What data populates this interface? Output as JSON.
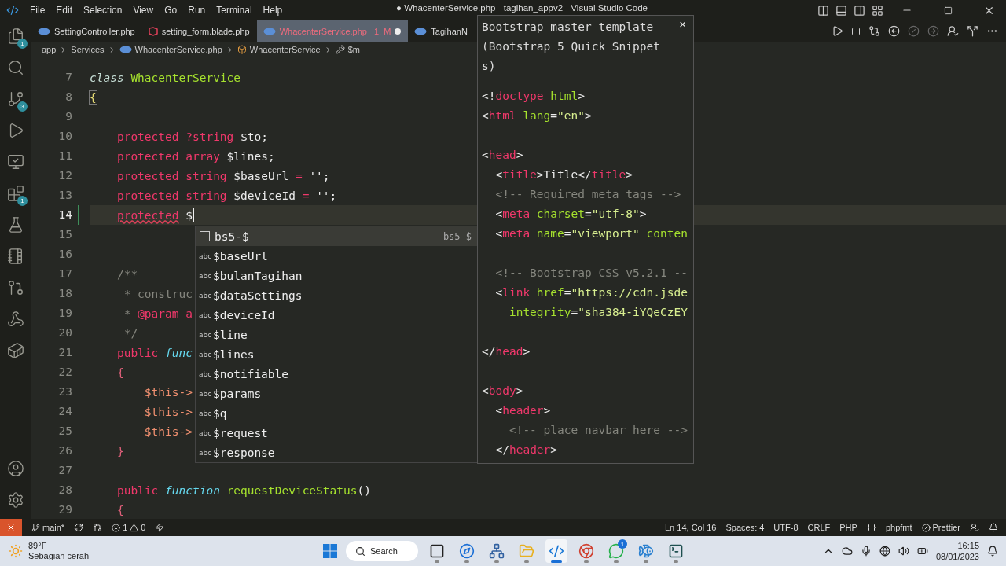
{
  "window": {
    "title": "● WhacenterService.php - tagihan_appv2 - Visual Studio Code"
  },
  "menu": [
    "File",
    "Edit",
    "Selection",
    "View",
    "Go",
    "Run",
    "Terminal",
    "Help"
  ],
  "activity_bar": [
    {
      "kind": "explorer",
      "badge": "1"
    },
    {
      "kind": "search"
    },
    {
      "kind": "source-control",
      "badge": "3"
    },
    {
      "kind": "run"
    },
    {
      "kind": "remote"
    },
    {
      "kind": "extensions",
      "badge": "1"
    },
    {
      "kind": "testing"
    },
    {
      "kind": "notebook"
    },
    {
      "kind": "git-graph"
    },
    {
      "kind": "api"
    },
    {
      "kind": "docker"
    }
  ],
  "activity_bottom": [
    {
      "kind": "account"
    },
    {
      "kind": "settings"
    }
  ],
  "tabs": [
    {
      "kind": "php",
      "label": "SettingController.php",
      "modified": false,
      "selected": false
    },
    {
      "kind": "blade",
      "label": "setting_form.blade.php",
      "modified": false,
      "selected": false
    },
    {
      "kind": "php",
      "label": "WhacenterService.php",
      "status": "1, M",
      "modified": true,
      "selected": true
    },
    {
      "kind": "php",
      "label": "TagihanN",
      "modified": false,
      "selected": false
    }
  ],
  "breadcrumb": [
    {
      "kind": "folder",
      "label": "app"
    },
    {
      "kind": "folder",
      "label": "Services"
    },
    {
      "kind": "php",
      "label": "WhacenterService.php"
    },
    {
      "kind": "class",
      "label": "WhacenterService"
    },
    {
      "kind": "property",
      "label": "$m"
    }
  ],
  "editor": {
    "lines": [
      {
        "number": "7",
        "current": false,
        "changed": false,
        "tokens": [
          {
            "kind": "italic",
            "text": "class "
          },
          {
            "kind": "classname",
            "text": "WhacenterService"
          }
        ]
      },
      {
        "number": "8",
        "current": false,
        "changed": false,
        "tokens": [
          {
            "kind": "bracket",
            "text": "{"
          }
        ]
      },
      {
        "number": "9",
        "current": false,
        "changed": false
      },
      {
        "number": "10",
        "current": false,
        "changed": false,
        "tokens": [
          {
            "kind": "keyword",
            "text": "    protected ?string"
          },
          {
            "kind": "plain",
            "text": " $to;"
          }
        ]
      },
      {
        "number": "11",
        "current": false,
        "changed": false,
        "tokens": [
          {
            "kind": "keyword",
            "text": "    protected array"
          },
          {
            "kind": "plain",
            "text": " $lines;"
          }
        ]
      },
      {
        "number": "12",
        "current": false,
        "changed": false,
        "tokens": [
          {
            "kind": "keyword",
            "text": "    protected string"
          },
          {
            "kind": "plain",
            "text": " $baseUrl "
          },
          {
            "kind": "keyword",
            "text": "="
          },
          {
            "kind": "plain",
            "text": " '';"
          }
        ]
      },
      {
        "number": "13",
        "current": false,
        "changed": false,
        "tokens": [
          {
            "kind": "keyword",
            "text": "    protected string"
          },
          {
            "kind": "plain",
            "text": " $deviceId "
          },
          {
            "kind": "keyword",
            "text": "="
          },
          {
            "kind": "plain",
            "text": " '';"
          }
        ]
      },
      {
        "number": "14",
        "current": true,
        "changed": true,
        "tokens": [
          {
            "kind": "error",
            "text": "    protected"
          },
          {
            "kind": "plain",
            "text": " $"
          }
        ]
      },
      {
        "number": "15",
        "current": false,
        "changed": false
      },
      {
        "number": "16",
        "current": false,
        "changed": false
      },
      {
        "number": "17",
        "current": false,
        "changed": false,
        "tokens": [
          {
            "kind": "comment",
            "text": "    /**"
          }
        ]
      },
      {
        "number": "18",
        "current": false,
        "changed": false,
        "tokens": [
          {
            "kind": "comment",
            "text": "     * construc"
          }
        ]
      },
      {
        "number": "19",
        "current": false,
        "changed": false,
        "tokens": [
          {
            "kind": "comment",
            "text": "     * "
          },
          {
            "kind": "keyword",
            "text": "@param a"
          }
        ]
      },
      {
        "number": "20",
        "current": false,
        "changed": false,
        "tokens": [
          {
            "kind": "comment",
            "text": "     */"
          }
        ]
      },
      {
        "number": "21",
        "current": false,
        "changed": false,
        "tokens": [
          {
            "kind": "keyword",
            "text": "    public "
          },
          {
            "kind": "storage",
            "text": "func"
          }
        ]
      },
      {
        "number": "22",
        "current": false,
        "changed": false,
        "tokens": [
          {
            "kind": "brace",
            "text": "    {"
          }
        ]
      },
      {
        "number": "23",
        "current": false,
        "changed": false,
        "tokens": [
          {
            "kind": "this",
            "text": "        $this->"
          }
        ]
      },
      {
        "number": "24",
        "current": false,
        "changed": false,
        "tokens": [
          {
            "kind": "this",
            "text": "        $this->"
          }
        ]
      },
      {
        "number": "25",
        "current": false,
        "changed": false,
        "tokens": [
          {
            "kind": "this",
            "text": "        $this->"
          }
        ]
      },
      {
        "number": "26",
        "current": false,
        "changed": false,
        "tokens": [
          {
            "kind": "brace",
            "text": "    }"
          }
        ]
      },
      {
        "number": "27",
        "current": false,
        "changed": false
      },
      {
        "number": "28",
        "current": false,
        "changed": false,
        "tokens": [
          {
            "kind": "keyword",
            "text": "    public "
          },
          {
            "kind": "storage",
            "text": "function "
          },
          {
            "kind": "function",
            "text": "requestDeviceStatus"
          },
          {
            "kind": "plain",
            "text": "()"
          }
        ]
      },
      {
        "number": "29",
        "current": false,
        "changed": false,
        "tokens": [
          {
            "kind": "brace",
            "text": "    {"
          }
        ]
      }
    ]
  },
  "suggestions": [
    {
      "kind": "snippet",
      "label": "bs5-$",
      "detail": "bs5-$",
      "selected": true
    },
    {
      "kind": "word",
      "icon_label": "abc",
      "label": "$baseUrl",
      "selected": false
    },
    {
      "kind": "word",
      "icon_label": "abc",
      "label": "$bulanTagihan",
      "selected": false
    },
    {
      "kind": "word",
      "icon_label": "abc",
      "label": "$dataSettings",
      "selected": false
    },
    {
      "kind": "word",
      "icon_label": "abc",
      "label": "$deviceId",
      "selected": false
    },
    {
      "kind": "word",
      "icon_label": "abc",
      "label": "$line",
      "selected": false
    },
    {
      "kind": "word",
      "icon_label": "abc",
      "label": "$lines",
      "selected": false
    },
    {
      "kind": "word",
      "icon_label": "abc",
      "label": "$notifiable",
      "selected": false
    },
    {
      "kind": "word",
      "icon_label": "abc",
      "label": "$params",
      "selected": false
    },
    {
      "kind": "word",
      "icon_label": "abc",
      "label": "$q",
      "selected": false
    },
    {
      "kind": "word",
      "icon_label": "abc",
      "label": "$request",
      "selected": false
    },
    {
      "kind": "word",
      "icon_label": "abc",
      "label": "$response",
      "selected": false
    }
  ],
  "snippet_detail": {
    "title": "Bootstrap master template (Bootstrap 5 Quick Snippets)",
    "close": "×",
    "blocks": [
      [
        {
          "tokens": [
            {
              "kind": "punct",
              "text": "<!"
            },
            {
              "kind": "tag",
              "text": "doctype"
            },
            {
              "kind": "attr",
              "text": " html"
            },
            {
              "kind": "punct",
              "text": ">"
            }
          ]
        },
        {
          "tokens": [
            {
              "kind": "punct",
              "text": "<"
            },
            {
              "kind": "tag",
              "text": "html"
            },
            {
              "kind": "attr",
              "text": " lang"
            },
            {
              "kind": "punct",
              "text": "="
            },
            {
              "kind": "string",
              "text": "\"en\""
            },
            {
              "kind": "punct",
              "text": ">"
            }
          ]
        }
      ],
      [
        {
          "tokens": [
            {
              "kind": "punct",
              "text": "<"
            },
            {
              "kind": "tag",
              "text": "head"
            },
            {
              "kind": "punct",
              "text": ">"
            }
          ]
        },
        {
          "tokens": [
            {
              "kind": "punct",
              "text": "  <"
            },
            {
              "kind": "tag",
              "text": "title"
            },
            {
              "kind": "punct",
              "text": ">Title</"
            },
            {
              "kind": "tag",
              "text": "title"
            },
            {
              "kind": "punct",
              "text": ">"
            }
          ]
        },
        {
          "tokens": [
            {
              "kind": "comment",
              "text": "  <!-- Required meta tags -->"
            }
          ]
        },
        {
          "tokens": [
            {
              "kind": "punct",
              "text": "  <"
            },
            {
              "kind": "tag",
              "text": "meta"
            },
            {
              "kind": "attr",
              "text": " charset"
            },
            {
              "kind": "punct",
              "text": "="
            },
            {
              "kind": "string",
              "text": "\"utf-8\""
            },
            {
              "kind": "punct",
              "text": ">"
            }
          ]
        },
        {
          "tokens": [
            {
              "kind": "punct",
              "text": "  <"
            },
            {
              "kind": "tag",
              "text": "meta"
            },
            {
              "kind": "attr",
              "text": " name"
            },
            {
              "kind": "punct",
              "text": "="
            },
            {
              "kind": "string",
              "text": "\"viewport\""
            },
            {
              "kind": "attr",
              "text": " conten"
            }
          ]
        }
      ],
      [
        {
          "tokens": [
            {
              "kind": "comment",
              "text": "  <!-- Bootstrap CSS v5.2.1 --"
            }
          ]
        },
        {
          "tokens": [
            {
              "kind": "punct",
              "text": "  <"
            },
            {
              "kind": "tag",
              "text": "link"
            },
            {
              "kind": "attr",
              "text": " href"
            },
            {
              "kind": "punct",
              "text": "="
            },
            {
              "kind": "string",
              "text": "\"https://cdn.jsde"
            }
          ]
        },
        {
          "tokens": [
            {
              "kind": "attr",
              "text": "    integrity"
            },
            {
              "kind": "punct",
              "text": "="
            },
            {
              "kind": "string",
              "text": "\"sha384-iYQeCzEY"
            }
          ]
        }
      ],
      [
        {
          "tokens": [
            {
              "kind": "punct",
              "text": "</"
            },
            {
              "kind": "tag",
              "text": "head"
            },
            {
              "kind": "punct",
              "text": ">"
            }
          ]
        }
      ],
      [
        {
          "tokens": [
            {
              "kind": "punct",
              "text": "<"
            },
            {
              "kind": "tag",
              "text": "body"
            },
            {
              "kind": "punct",
              "text": ">"
            }
          ]
        },
        {
          "tokens": [
            {
              "kind": "punct",
              "text": "  <"
            },
            {
              "kind": "tag",
              "text": "header"
            },
            {
              "kind": "punct",
              "text": ">"
            }
          ]
        },
        {
          "tokens": [
            {
              "kind": "comment",
              "text": "    <!-- place navbar here -->"
            }
          ]
        },
        {
          "tokens": [
            {
              "kind": "punct",
              "text": "  </"
            },
            {
              "kind": "tag",
              "text": "header"
            },
            {
              "kind": "punct",
              "text": ">"
            }
          ]
        }
      ]
    ]
  },
  "status_bar": {
    "branch": "main*",
    "errors": "1",
    "warnings": "0",
    "items": [
      "Ln 14, Col 16",
      "Spaces: 4",
      "UTF-8",
      "CRLF",
      "PHP"
    ],
    "formatter": "phpfmt",
    "prettier": "Prettier"
  },
  "taskbar": {
    "weather": {
      "temperature": "89°F",
      "condition": "Sebagian cerah"
    },
    "search": "Search",
    "apps": [
      {
        "kind": "task-view",
        "active": false
      },
      {
        "kind": "browser",
        "active": false
      },
      {
        "kind": "network",
        "active": false
      },
      {
        "kind": "folder",
        "active": false
      },
      {
        "kind": "code",
        "active": true
      },
      {
        "kind": "chrome",
        "active": false
      },
      {
        "kind": "chat",
        "active": false,
        "badge": "1"
      },
      {
        "kind": "dolphin",
        "active": false
      },
      {
        "kind": "terminal",
        "active": false
      }
    ],
    "time": "16:15",
    "date": "08/01/2023"
  }
}
